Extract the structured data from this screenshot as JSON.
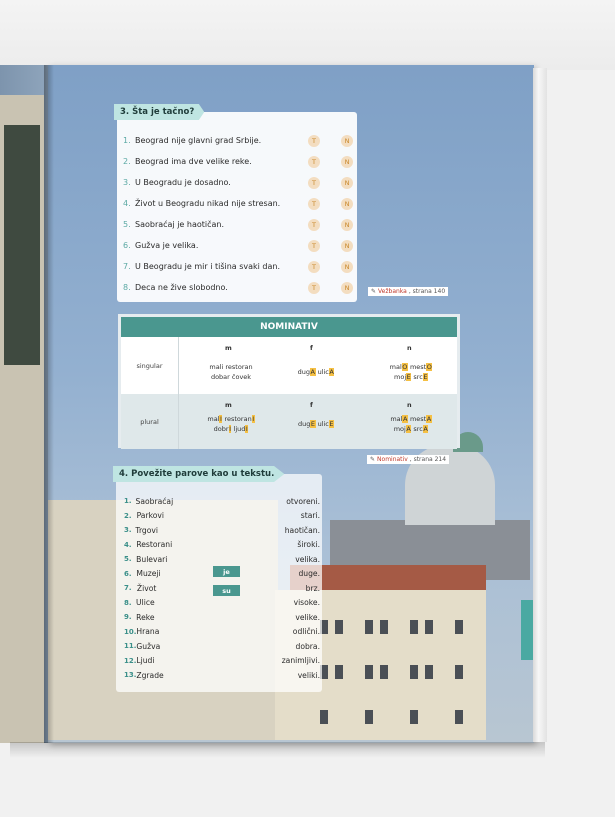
{
  "exercise3": {
    "title": "3. Šta je tačno?",
    "true_label": "T",
    "false_label": "N",
    "items": [
      {
        "num": "1.",
        "text": "Beograd nije glavni grad Srbije."
      },
      {
        "num": "2.",
        "text": "Beograd ima dve velike reke."
      },
      {
        "num": "3.",
        "text": "U Beogradu je dosadno."
      },
      {
        "num": "4.",
        "text": "Život u Beogradu nikad nije stresan."
      },
      {
        "num": "5.",
        "text": "Saobraćaj je haotičan."
      },
      {
        "num": "6.",
        "text": "Gužva je velika."
      },
      {
        "num": "7.",
        "text": "U Beogradu je mir i tišina svaki dan."
      },
      {
        "num": "8.",
        "text": "Deca ne žive slobodno."
      }
    ],
    "ref_highlight": "Vežbanka",
    "ref_text": ", strana 140"
  },
  "nominativ": {
    "title": "NOMINATIV",
    "genders": [
      "m",
      "f",
      "n"
    ],
    "singular_label": "singular",
    "plural_label": "plural",
    "ref_highlight": "Nominativ",
    "ref_text": ", strana 214"
  },
  "exercise4": {
    "title": "4. Povežite parove kao u tekstu.",
    "verbs": [
      "je",
      "su"
    ],
    "items": [
      {
        "num": "1.",
        "left": "Saobraćaj",
        "right": "otvoreni."
      },
      {
        "num": "2.",
        "left": "Parkovi",
        "right": "stari."
      },
      {
        "num": "3.",
        "left": "Trgovi",
        "right": "haotičan."
      },
      {
        "num": "4.",
        "left": "Restorani",
        "right": "široki."
      },
      {
        "num": "5.",
        "left": "Bulevari",
        "right": "velika."
      },
      {
        "num": "6.",
        "left": "Muzeji",
        "right": "duge."
      },
      {
        "num": "7.",
        "left": "Život",
        "right": "brz."
      },
      {
        "num": "8.",
        "left": "Ulice",
        "right": "visoke."
      },
      {
        "num": "9.",
        "left": "Reke",
        "right": "velike."
      },
      {
        "num": "10.",
        "left": "Hrana",
        "right": "odlični."
      },
      {
        "num": "11.",
        "left": "Gužva",
        "right": "dobra."
      },
      {
        "num": "12.",
        "left": "Ljudi",
        "right": "zanimljivi."
      },
      {
        "num": "13.",
        "left": "Zgrade",
        "right": "veliki."
      }
    ]
  },
  "colors": {
    "accent": "#4a978f",
    "tag": "#bfe5e2",
    "highlight": "#f5c044"
  }
}
